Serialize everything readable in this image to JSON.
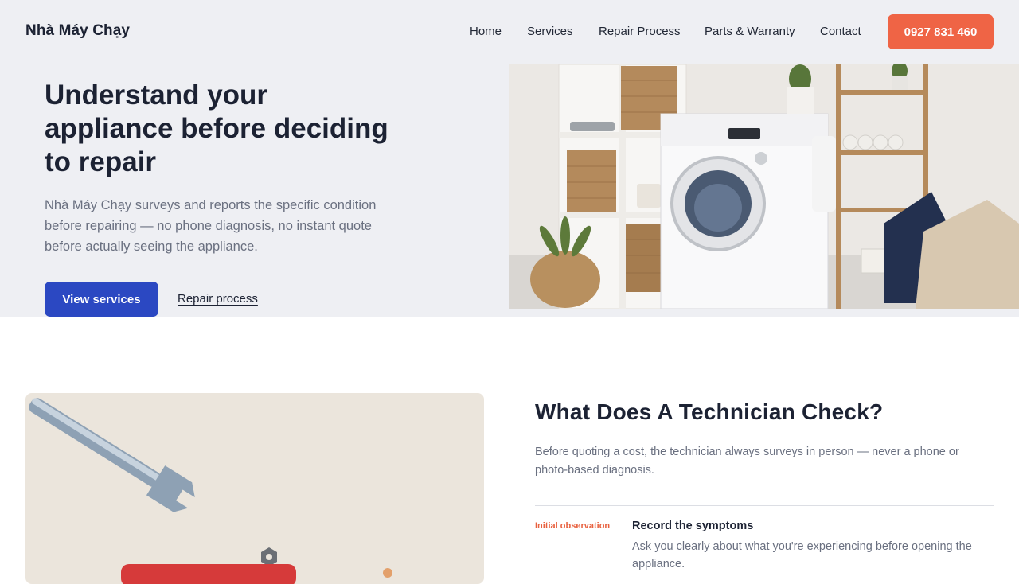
{
  "brand": {
    "name": "Nhà Máy Chạy",
    "phone": "0927 831 460"
  },
  "nav": [
    {
      "label": "Home"
    },
    {
      "label": "Services"
    },
    {
      "label": "Repair Process"
    },
    {
      "label": "Parts & Warranty"
    },
    {
      "label": "Contact"
    }
  ],
  "hero": {
    "title": "Understand your appliance before deciding to repair",
    "description": "Nhà Máy Chạy surveys and reports the specific condition before repairing — no phone diagnosis, no instant quote before actually seeing the appliance.",
    "primary_cta": "View services",
    "secondary_cta": "Repair process"
  },
  "check_section": {
    "title": "What Does A Technician Check?",
    "description": "Before quoting a cost, the technician always surveys in person — never a phone or photo-based diagnosis.",
    "steps": [
      {
        "tag": "Initial observation",
        "title": "Record the symptoms",
        "description": "Ask you clearly about what you're experiencing before opening the appliance."
      }
    ]
  },
  "colors": {
    "accent": "#ef6445",
    "primary": "#2b48c2",
    "hero_bg": "#eeeff3"
  }
}
